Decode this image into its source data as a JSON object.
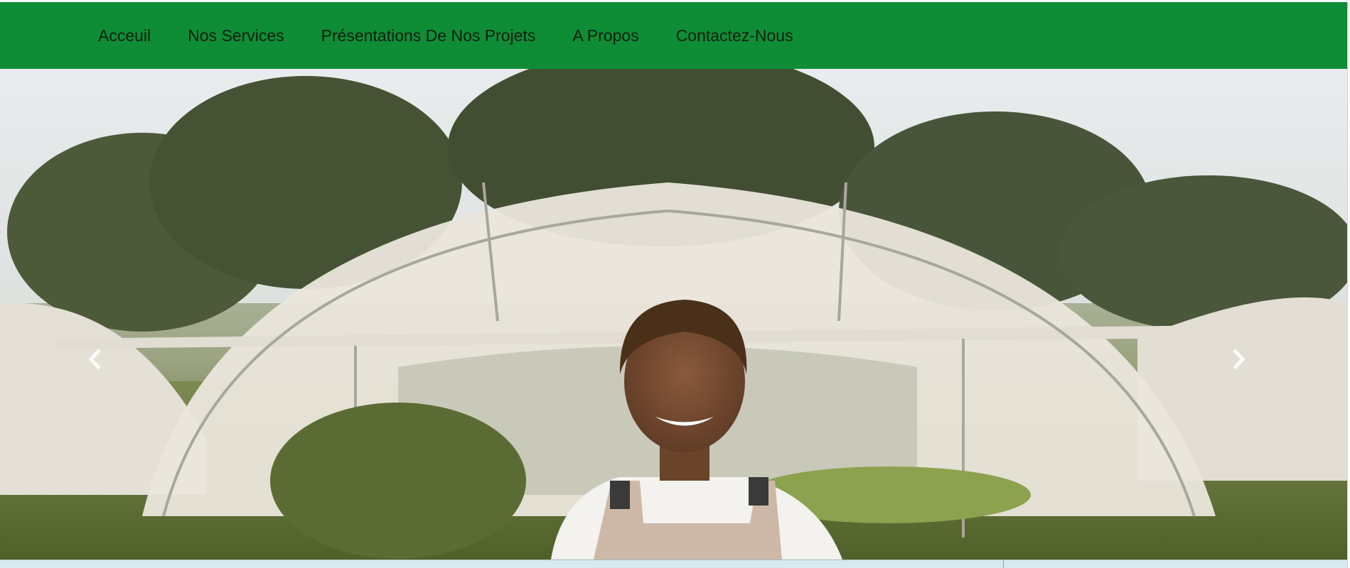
{
  "nav": {
    "items": [
      {
        "label": "Acceuil"
      },
      {
        "label": "Nos Services"
      },
      {
        "label": "Présentations De Nos Projets"
      },
      {
        "label": "A Propos"
      },
      {
        "label": "Contactez-Nous"
      }
    ]
  },
  "hero": {
    "prev_icon": "chevron-left-icon",
    "next_icon": "chevron-right-icon"
  },
  "colors": {
    "navbar_bg": "#0f8d36",
    "nav_text": "#0b1f10",
    "bottom_strip": "#d8eaee"
  }
}
